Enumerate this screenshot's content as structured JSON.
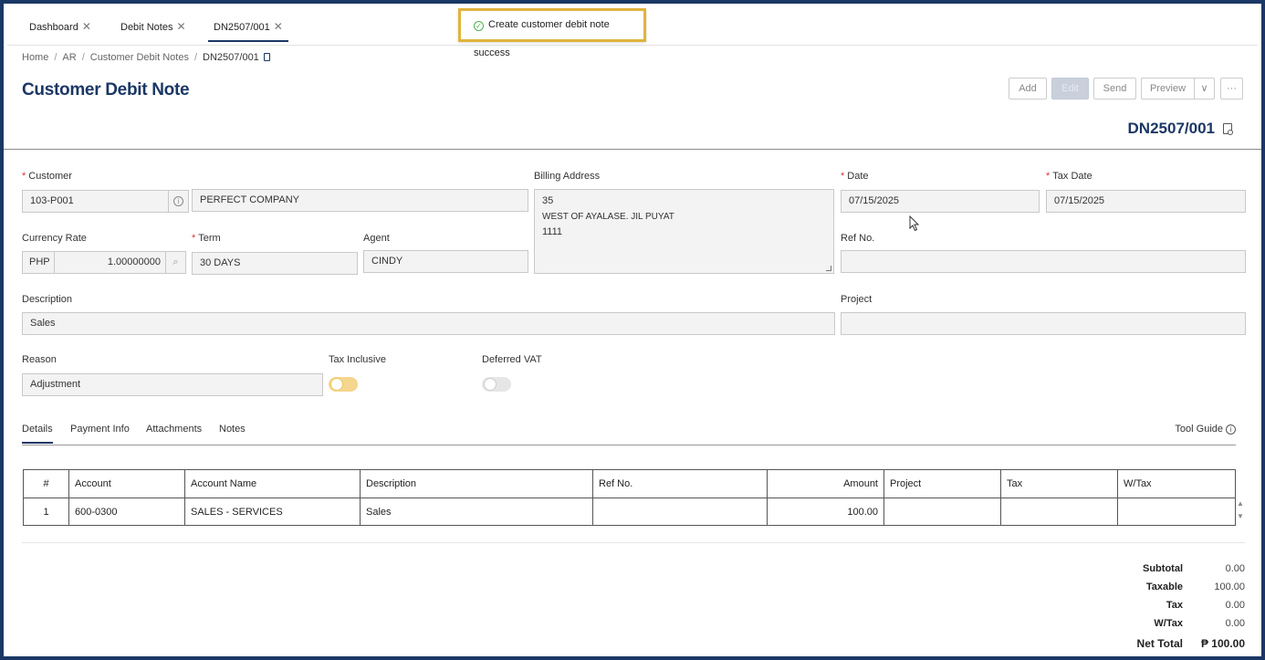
{
  "tabs": [
    {
      "label": "Dashboard",
      "close": "✕"
    },
    {
      "label": "Debit Notes",
      "close": "✕"
    },
    {
      "label": "DN2507/001",
      "close": "✕"
    }
  ],
  "toast": {
    "message": "Create customer debit note success"
  },
  "breadcrumb": [
    "Home",
    "AR",
    "Customer Debit Notes",
    "DN2507/001"
  ],
  "breadcrumb_sep": "/",
  "page_title": "Customer Debit Note",
  "toolbar": {
    "add": "Add",
    "edit": "Edit",
    "send": "Send",
    "preview": "Preview",
    "dropdown": "∨",
    "more": "···"
  },
  "document_number": "DN2507/001",
  "form": {
    "customer_label": "Customer",
    "customer_code": "103-P001",
    "customer_name": "PERFECT COMPANY",
    "billing_address_label": "Billing Address",
    "billing_address_lines": [
      "35",
      "WEST OF AYALASE. JIL PUYAT",
      "1111"
    ],
    "date_label": "Date",
    "date_value": "07/15/2025",
    "tax_date_label": "Tax Date",
    "tax_date_value": "07/15/2025",
    "currency_rate_label": "Currency Rate",
    "currency": "PHP",
    "rate": "1.00000000",
    "term_label": "Term",
    "term_value": "30 DAYS",
    "agent_label": "Agent",
    "agent_value": "CINDY",
    "ref_no_label": "Ref No.",
    "ref_no_value": "",
    "description_label": "Description",
    "description_value": "Sales",
    "project_label": "Project",
    "project_value": "",
    "reason_label": "Reason",
    "reason_value": "Adjustment",
    "tax_inclusive_label": "Tax Inclusive",
    "tax_inclusive": true,
    "deferred_vat_label": "Deferred VAT",
    "deferred_vat": false,
    "required_mark": "*"
  },
  "subtabs": [
    "Details",
    "Payment Info",
    "Attachments",
    "Notes"
  ],
  "tool_guide": "Tool Guide",
  "grid": {
    "columns": [
      "#",
      "Account",
      "Account Name",
      "Description",
      "Ref No.",
      "Amount",
      "Project",
      "Tax",
      "W/Tax"
    ],
    "rows": [
      [
        "1",
        "600-0300",
        "SALES - SERVICES",
        "Sales",
        "",
        "100.00",
        "",
        "",
        ""
      ]
    ]
  },
  "totals": [
    {
      "label": "Subtotal",
      "value": "0.00"
    },
    {
      "label": "Taxable",
      "value": "100.00"
    },
    {
      "label": "Tax",
      "value": "0.00"
    },
    {
      "label": "W/Tax",
      "value": "0.00"
    }
  ],
  "net_total": {
    "label": "Net Total",
    "value": "₱ 100.00"
  },
  "colors": {
    "brand": "#1b3765",
    "toast_border": "#e0b43c",
    "toggle_on": "#f4d68e",
    "required": "#d33333"
  }
}
